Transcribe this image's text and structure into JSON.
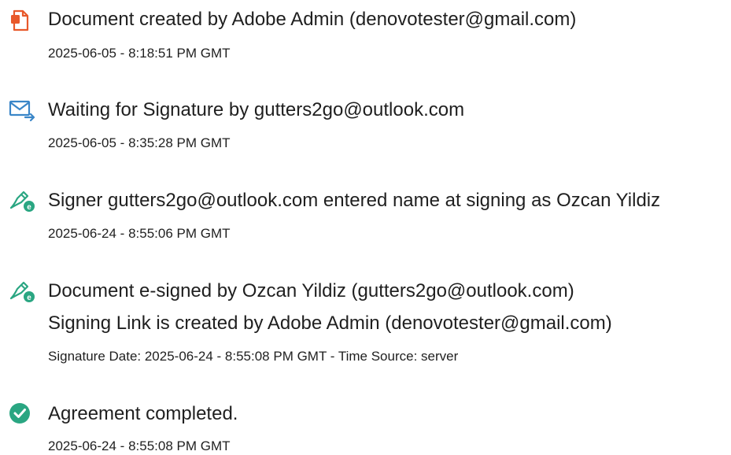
{
  "events": [
    {
      "icon": "document-created-icon",
      "title": "Document created by Adobe Admin (denovotester@gmail.com)",
      "timestamp": "2025-06-05 - 8:18:51 PM GMT"
    },
    {
      "icon": "email-sent-icon",
      "title": "Waiting for Signature by gutters2go@outlook.com",
      "timestamp": "2025-06-05 - 8:35:28 PM GMT"
    },
    {
      "icon": "e-sign-pen-icon",
      "title": "Signer gutters2go@outlook.com entered name at signing as Ozcan Yildiz",
      "timestamp": "2025-06-24 - 8:55:06 PM GMT"
    },
    {
      "icon": "e-sign-pen-icon",
      "title": "Document e-signed by Ozcan Yildiz (gutters2go@outlook.com)",
      "subtitle": "Signing Link is created by Adobe Admin (denovotester@gmail.com)",
      "timestamp": "Signature Date: 2025-06-24 - 8:55:08 PM GMT - Time Source: server"
    },
    {
      "icon": "check-circle-icon",
      "title": "Agreement completed.",
      "timestamp": "2025-06-24 - 8:55:08 PM GMT"
    }
  ],
  "colors": {
    "document_icon": "#e8592b",
    "email_icon": "#3a86c8",
    "sign_icon": "#2aa682",
    "complete_icon": "#2aa682",
    "text": "#1f1f1f"
  }
}
